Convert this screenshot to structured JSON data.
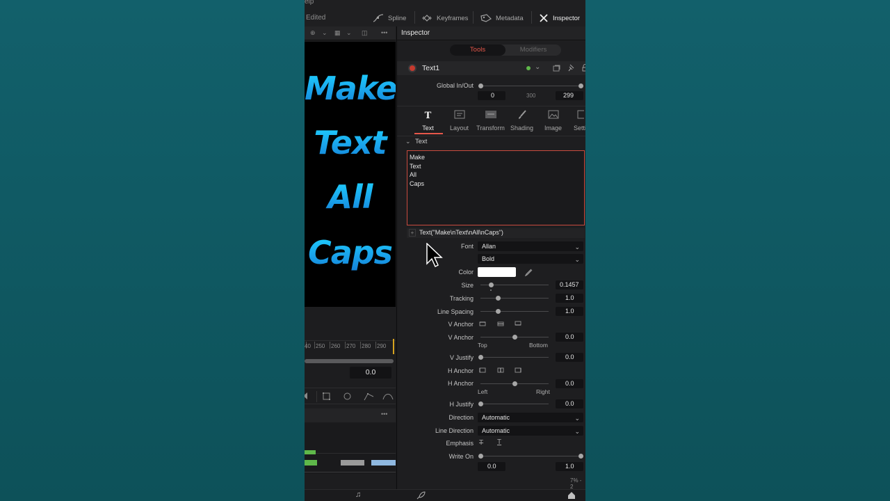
{
  "app": {
    "menu_fragment": "elp",
    "project_status": "Edited",
    "pages": [
      {
        "label": "Spline"
      },
      {
        "label": "Keyframes"
      },
      {
        "label": "Metadata"
      },
      {
        "label": "Inspector"
      }
    ]
  },
  "viewer": {
    "lines": [
      "Make",
      "Text",
      "All",
      "Caps"
    ]
  },
  "timeline": {
    "ticks": [
      "40",
      "250",
      "260",
      "270",
      "280",
      "290"
    ],
    "timecode": "0.0"
  },
  "inspector": {
    "title": "Inspector",
    "segments": {
      "tools": "Tools",
      "modifiers": "Modifiers"
    },
    "node_name": "Text1",
    "global_inout": {
      "label": "Global In/Out",
      "in": "0",
      "mid": "300",
      "out": "299"
    },
    "tabs": [
      {
        "label": "Text",
        "icon": "T"
      },
      {
        "label": "Layout"
      },
      {
        "label": "Transform"
      },
      {
        "label": "Shading"
      },
      {
        "label": "Image"
      },
      {
        "label": "Setti"
      }
    ],
    "section_title": "Text",
    "styled_text": [
      "Make",
      "Text",
      "All",
      "Caps"
    ],
    "expression": "Text(\"Make\\nText\\nAll\\nCaps\")",
    "font": {
      "label": "Font",
      "family": "Allan",
      "style": "Bold"
    },
    "color_label": "Color",
    "size": {
      "label": "Size",
      "value": "0.1457",
      "fraction": 0.15
    },
    "tracking": {
      "label": "Tracking",
      "value": "1.0",
      "fraction": 0.25
    },
    "line_spacing": {
      "label": "Line Spacing",
      "value": "1.0",
      "fraction": 0.25
    },
    "v_anchor_buttons_label": "V Anchor",
    "v_anchor": {
      "label": "V Anchor",
      "value": "0.0",
      "left": "Top",
      "right": "Bottom",
      "fraction": 0.5
    },
    "v_justify": {
      "label": "V Justify",
      "value": "0.0",
      "fraction": 0.0
    },
    "h_anchor_buttons_label": "H Anchor",
    "h_anchor": {
      "label": "H Anchor",
      "value": "0.0",
      "left": "Left",
      "right": "Right",
      "fraction": 0.5
    },
    "h_justify": {
      "label": "H Justify",
      "value": "0.0",
      "fraction": 0.0
    },
    "direction": {
      "label": "Direction",
      "value": "Automatic"
    },
    "line_direction": {
      "label": "Line Direction",
      "value": "Automatic"
    },
    "emphasis_label": "Emphasis",
    "write_on": {
      "label": "Write On",
      "start": "0.0",
      "end": "1.0"
    },
    "zoom_readout": "7% - 2"
  },
  "colors": {
    "accent_red": "#e6574a",
    "node_green": "#5fb84a",
    "text_gradient_top": "#1fd4ff",
    "text_gradient_bottom": "#1480d6",
    "background": "#0f5560"
  }
}
